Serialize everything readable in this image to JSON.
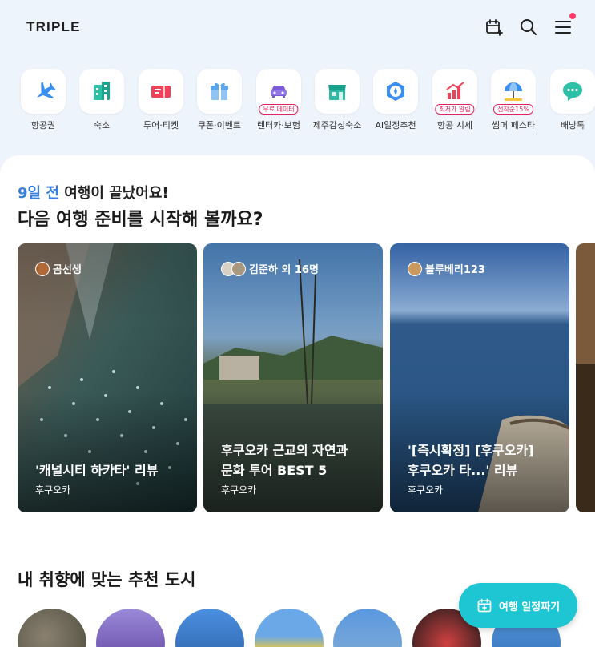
{
  "header": {
    "logo": "TRIPLE"
  },
  "categories": [
    {
      "label": "항공권",
      "icon": "airplane-icon",
      "badge": ""
    },
    {
      "label": "숙소",
      "icon": "hotel-icon",
      "badge": ""
    },
    {
      "label": "투어·티켓",
      "icon": "ticket-icon",
      "badge": ""
    },
    {
      "label": "쿠폰·이벤트",
      "icon": "gift-icon",
      "badge": ""
    },
    {
      "label": "렌터카·보험",
      "icon": "car-icon",
      "badge": "무료 데이터"
    },
    {
      "label": "제주감성숙소",
      "icon": "store-icon",
      "badge": ""
    },
    {
      "label": "AI일정추천",
      "icon": "compass-icon",
      "badge": ""
    },
    {
      "label": "항공 시세",
      "icon": "chart-plane-icon",
      "badge": "최저가 알림"
    },
    {
      "label": "썸머 페스타",
      "icon": "beach-umbrella-icon",
      "badge": "선착순15%"
    },
    {
      "label": "배낭톡",
      "icon": "chat-icon",
      "badge": ""
    }
  ],
  "trip": {
    "days_ago": "9일 전",
    "ended_text": "여행이 끝났어요!",
    "title": "다음 여행 준비를 시작해 볼까요?"
  },
  "cards": [
    {
      "author": "곰선생",
      "title": "'캐널시티 하카타' 리뷰",
      "location": "후쿠오카"
    },
    {
      "author": "김준하 외 16명",
      "title": "후쿠오카 근교의 자연과\n문화 투어 BEST 5",
      "location": "후쿠오카"
    },
    {
      "author": "블루베리123",
      "title": "'[즉시확정] [후쿠오카]\n후쿠오카 타...' 리뷰",
      "location": "후쿠오카"
    }
  ],
  "recommend": {
    "title": "내 취향에 맞는 추천 도시"
  },
  "fab": {
    "label": "여행 일정짜기"
  },
  "colors": {
    "accent": "#3a7fdc",
    "fab": "#1ec6d3",
    "badge": "#e0245e",
    "notification": "#ff3b6b"
  }
}
